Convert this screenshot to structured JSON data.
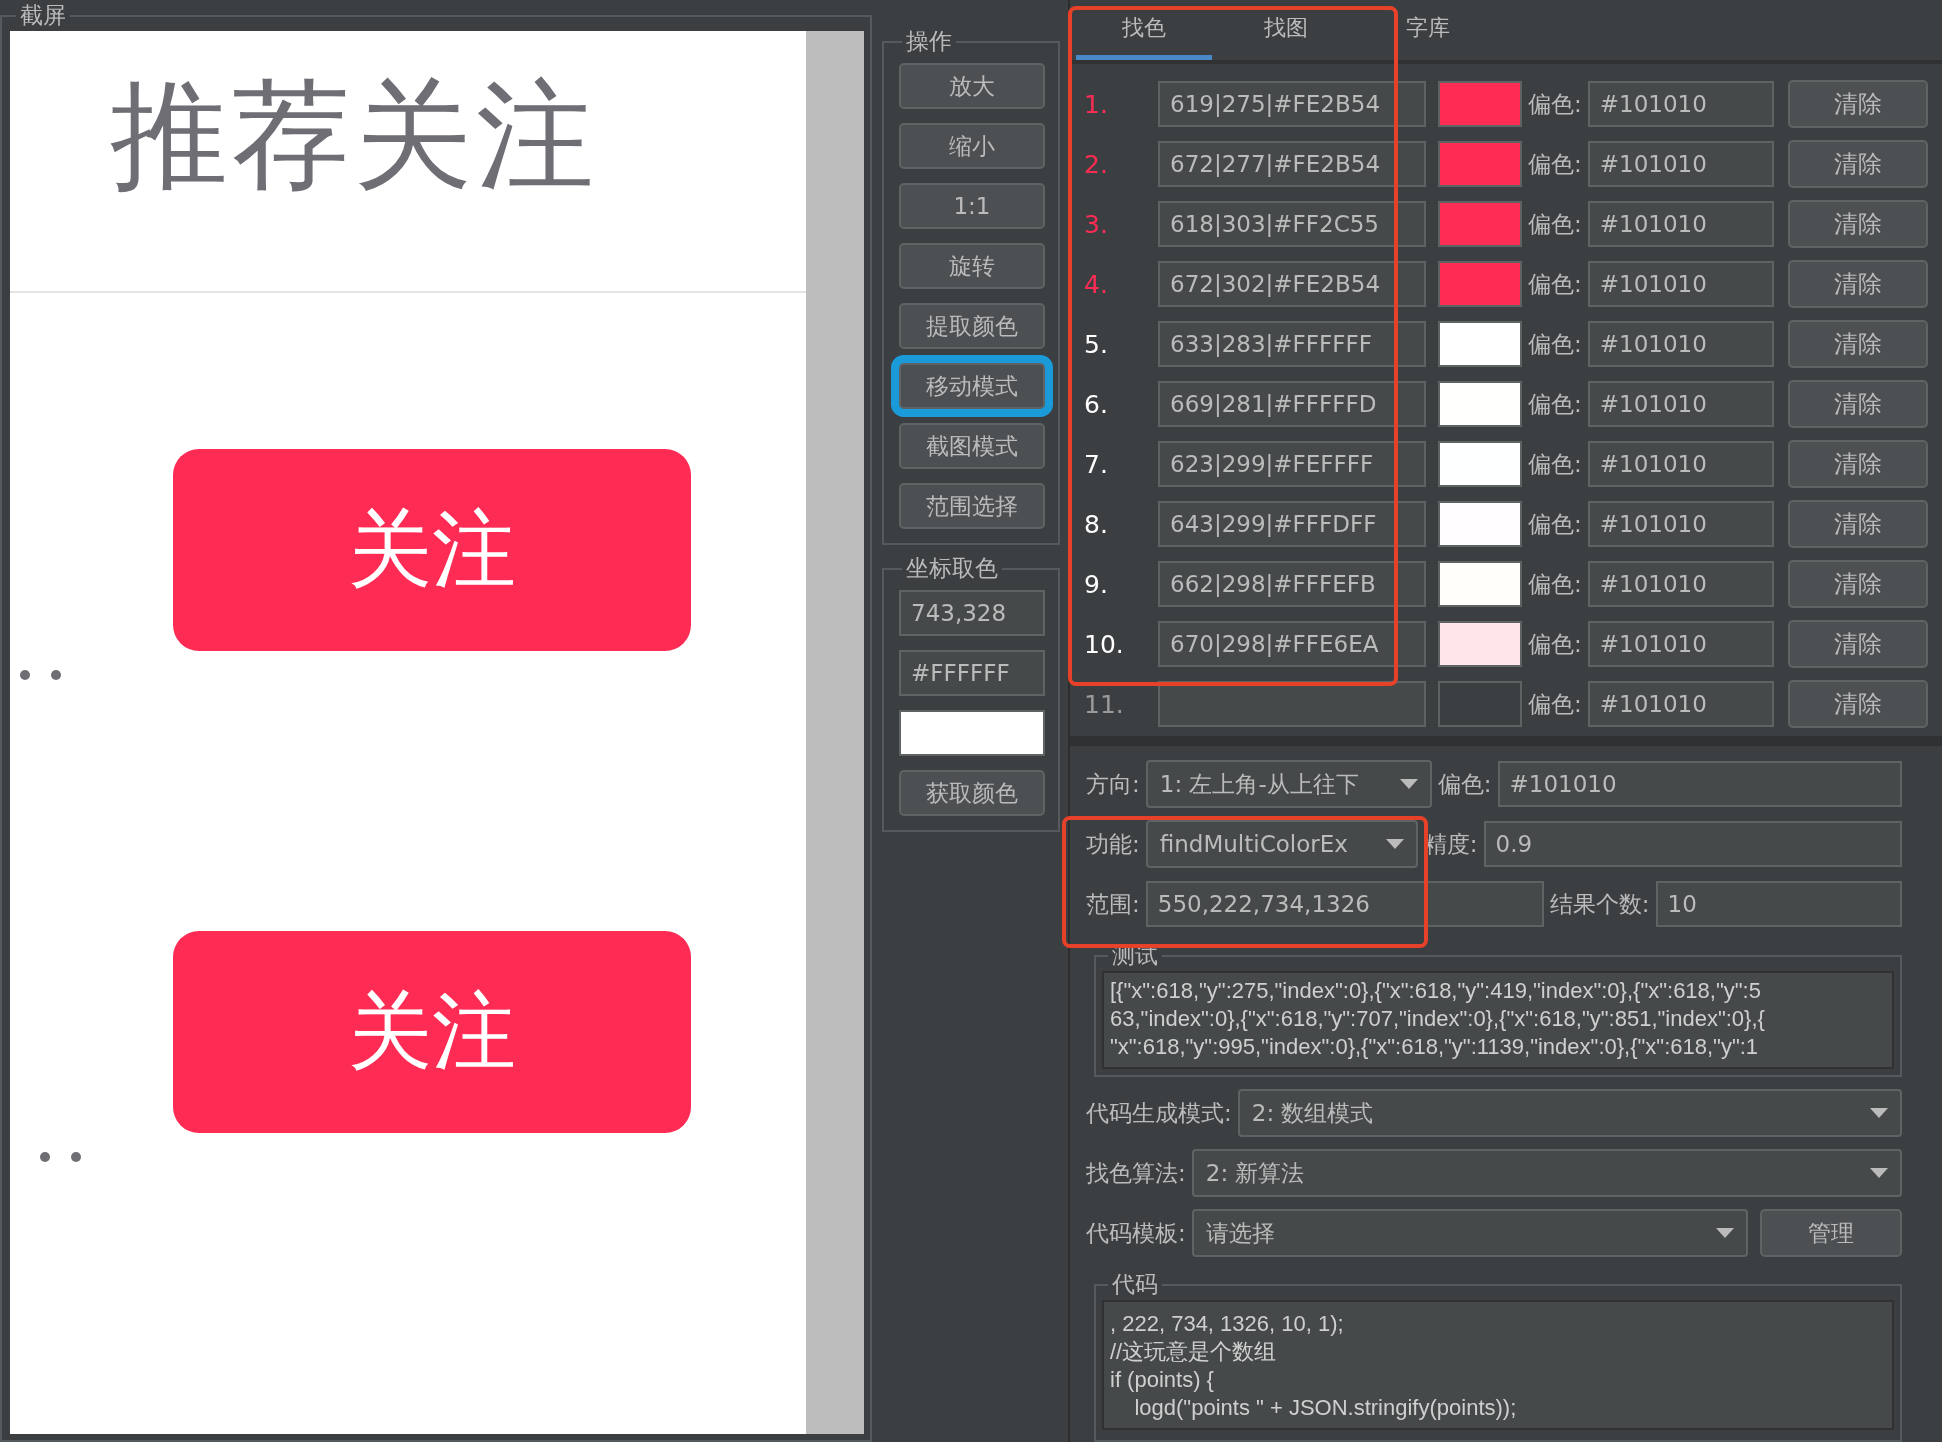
{
  "screenshot_panel": {
    "title": "截屏",
    "heading": "推荐关注",
    "follow_buttons": [
      "关注",
      "关注"
    ]
  },
  "operations": {
    "title": "操作",
    "buttons": [
      {
        "label": "放大",
        "focused": false
      },
      {
        "label": "缩小",
        "focused": false
      },
      {
        "label": "1:1",
        "focused": false
      },
      {
        "label": "旋转",
        "focused": false
      },
      {
        "label": "提取颜色",
        "focused": false
      },
      {
        "label": "移动模式",
        "focused": true
      },
      {
        "label": "截图模式",
        "focused": false
      },
      {
        "label": "范围选择",
        "focused": false
      }
    ]
  },
  "coordinate_picker": {
    "title": "坐标取色",
    "coordinate": "743,328",
    "color_value": "#FFFFFF",
    "color": "#ffffff",
    "button": "获取颜色"
  },
  "tabs": [
    {
      "label": "找色",
      "selected": true
    },
    {
      "label": "找图",
      "selected": false
    },
    {
      "label": "字库",
      "selected": false
    }
  ],
  "color_points": [
    {
      "number": "1.",
      "value": "619|275|#FE2B54",
      "color": "#fe2b54",
      "highlighted": true,
      "offset_label": "偏色:",
      "offset": "#101010",
      "button": "清除"
    },
    {
      "number": "2.",
      "value": "672|277|#FE2B54",
      "color": "#fe2b54",
      "highlighted": true,
      "offset_label": "偏色:",
      "offset": "#101010",
      "button": "清除"
    },
    {
      "number": "3.",
      "value": "618|303|#FF2C55",
      "color": "#ff2c55",
      "highlighted": true,
      "offset_label": "偏色:",
      "offset": "#101010",
      "button": "清除"
    },
    {
      "number": "4.",
      "value": "672|302|#FE2B54",
      "color": "#fe2b54",
      "highlighted": true,
      "offset_label": "偏色:",
      "offset": "#101010",
      "button": "清除"
    },
    {
      "number": "5.",
      "value": "633|283|#FFFFFF",
      "color": "#ffffff",
      "highlighted": false,
      "offset_label": "偏色:",
      "offset": "#101010",
      "button": "清除"
    },
    {
      "number": "6.",
      "value": "669|281|#FFFFFD",
      "color": "#fffffd",
      "highlighted": false,
      "offset_label": "偏色:",
      "offset": "#101010",
      "button": "清除"
    },
    {
      "number": "7.",
      "value": "623|299|#FEFFFF",
      "color": "#feffff",
      "highlighted": false,
      "offset_label": "偏色:",
      "offset": "#101010",
      "button": "清除"
    },
    {
      "number": "8.",
      "value": "643|299|#FFFDFF",
      "color": "#fffdff",
      "highlighted": false,
      "offset_label": "偏色:",
      "offset": "#101010",
      "button": "清除"
    },
    {
      "number": "9.",
      "value": "662|298|#FFFEFB",
      "color": "#fffefb",
      "highlighted": false,
      "offset_label": "偏色:",
      "offset": "#101010",
      "button": "清除"
    },
    {
      "number": "10.",
      "value": "670|298|#FFE6EA",
      "color": "#ffe6ea",
      "highlighted": false,
      "offset_label": "偏色:",
      "offset": "#101010",
      "button": "清除"
    },
    {
      "number": "11.",
      "highlighted": false,
      "offset_label": "偏色:",
      "offset": "#101010",
      "button": "清除"
    }
  ],
  "form": {
    "direction": {
      "label": "方向:",
      "value": "1: 左上角-从上往下"
    },
    "offset": {
      "label": "偏色:",
      "value": "#101010"
    },
    "function": {
      "label": "功能:",
      "value": "findMultiColorEx"
    },
    "precision": {
      "label": "精度:",
      "value": "0.9"
    },
    "range": {
      "label": "范围:",
      "value": "550,222,734,1326"
    },
    "result_count": {
      "label": "结果个数:",
      "value": "10"
    }
  },
  "test": {
    "title": "测试",
    "lines": [
      "[{\"x\":618,\"y\":275,\"index\":0},{\"x\":618,\"y\":419,\"index\":0},{\"x\":618,\"y\":5",
      "63,\"index\":0},{\"x\":618,\"y\":707,\"index\":0},{\"x\":618,\"y\":851,\"index\":0},{",
      "\"x\":618,\"y\":995,\"index\":0},{\"x\":618,\"y\":1139,\"index\":0},{\"x\":618,\"y\":1"
    ]
  },
  "code_mode": {
    "label": "代码生成模式:",
    "value": "2: 数组模式"
  },
  "algorithm": {
    "label": "找色算法:",
    "value": "2: 新算法"
  },
  "template": {
    "label": "代码模板:",
    "value": "请选择",
    "button": "管理"
  },
  "code": {
    "title": "代码",
    "lines": [
      ", 222, 734, 1326, 10, 1);",
      "//这玩意是个数组",
      "if (points) {",
      "    logd(\"points \" + JSON.stringify(points));"
    ]
  }
}
